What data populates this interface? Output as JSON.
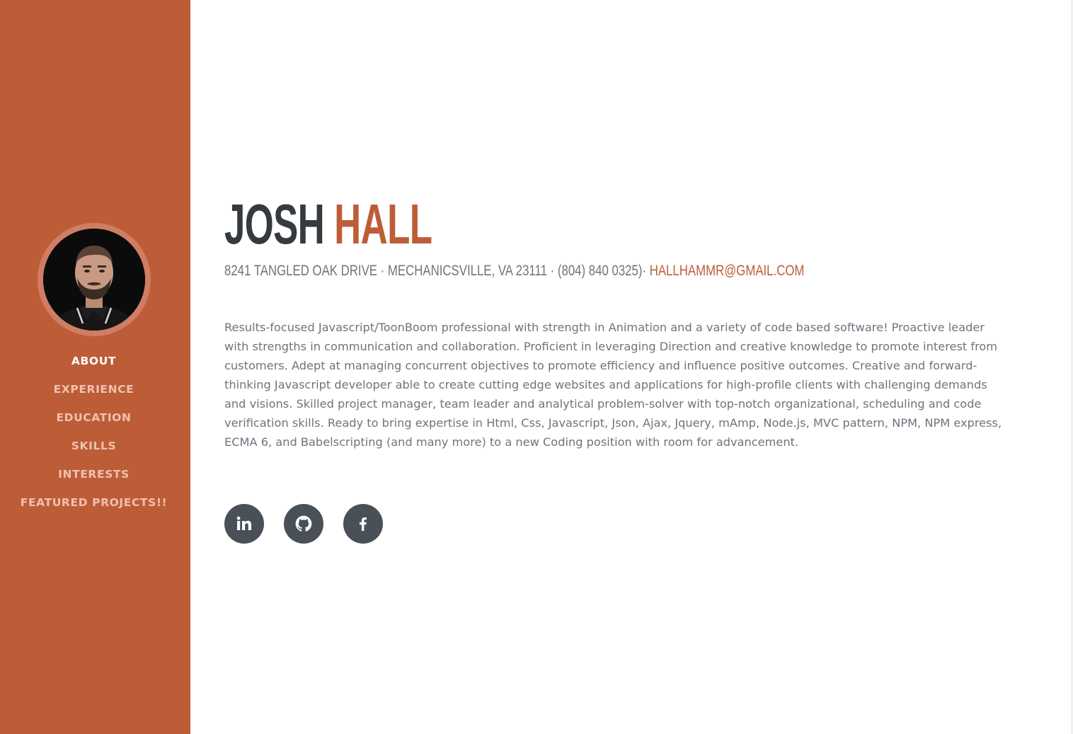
{
  "sidebar": {
    "avatar_alt": "Profile photo",
    "nav": [
      {
        "label": "ABOUT",
        "active": true
      },
      {
        "label": "EXPERIENCE",
        "active": false
      },
      {
        "label": "EDUCATION",
        "active": false
      },
      {
        "label": "SKILLS",
        "active": false
      },
      {
        "label": "INTERESTS",
        "active": false
      },
      {
        "label": "FEATURED PROJECTS!!",
        "active": false
      }
    ]
  },
  "main": {
    "first_name": "JOSH",
    "last_name": "HALL",
    "contact": {
      "address": "8241 Tangled Oak Drive · Mechanicsville, VA 23111 · (804) 840 0325)· ",
      "email": "hallhammr@gmail.com"
    },
    "bio": "Results-focused Javascript/ToonBoom professional with strength in Animation and a variety of code based software! Proactive leader with strengths in communication and collaboration. Proficient in leveraging Direction and creative knowledge to promote interest from customers. Adept at managing concurrent objectives to promote efficiency and influence positive outcomes. Creative and forward-thinking Javascript developer able to create cutting edge websites and applications for high-profile clients with challenging demands and visions. Skilled project manager, team leader and analytical problem-solver with top-notch organizational, scheduling and code verification skills. Ready to bring expertise in Html, Css, Javascript, Json, Ajax, Jquery, mAmp, Node.js, MVC pattern, NPM, NPM express, ECMA 6, and Babelscripting (and many more) to a new Coding position with room for advancement.",
    "social": [
      {
        "icon": "linkedin-icon"
      },
      {
        "icon": "github-icon"
      },
      {
        "icon": "facebook-icon"
      }
    ]
  },
  "colors": {
    "primary": "#bd5d38",
    "dark": "#343a40",
    "muted": "#6c757d",
    "social_bg": "#495057",
    "nav_inactive": "#f0c1af",
    "nav_active": "#ffffff"
  }
}
